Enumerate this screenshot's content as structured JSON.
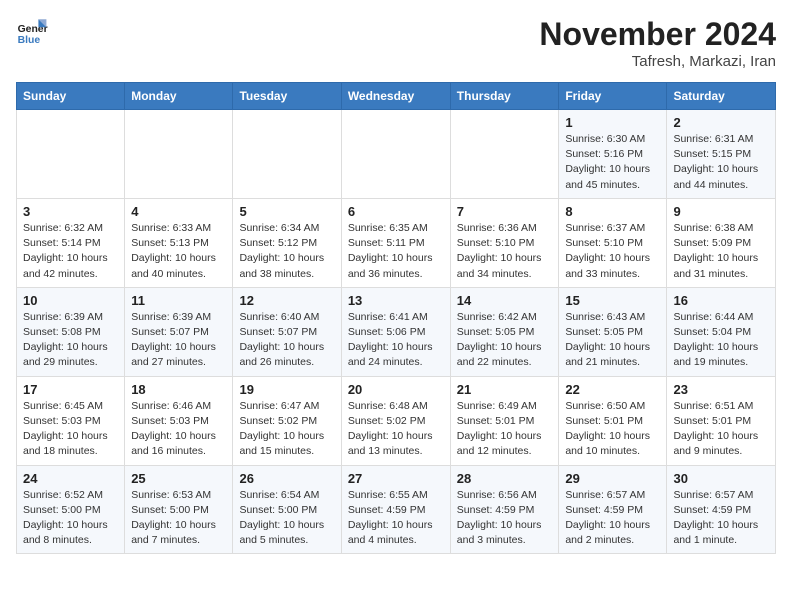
{
  "logo": {
    "line1": "General",
    "line2": "Blue"
  },
  "title": "November 2024",
  "subtitle": "Tafresh, Markazi, Iran",
  "weekdays": [
    "Sunday",
    "Monday",
    "Tuesday",
    "Wednesday",
    "Thursday",
    "Friday",
    "Saturday"
  ],
  "weeks": [
    [
      {
        "day": "",
        "info": ""
      },
      {
        "day": "",
        "info": ""
      },
      {
        "day": "",
        "info": ""
      },
      {
        "day": "",
        "info": ""
      },
      {
        "day": "",
        "info": ""
      },
      {
        "day": "1",
        "info": "Sunrise: 6:30 AM\nSunset: 5:16 PM\nDaylight: 10 hours\nand 45 minutes."
      },
      {
        "day": "2",
        "info": "Sunrise: 6:31 AM\nSunset: 5:15 PM\nDaylight: 10 hours\nand 44 minutes."
      }
    ],
    [
      {
        "day": "3",
        "info": "Sunrise: 6:32 AM\nSunset: 5:14 PM\nDaylight: 10 hours\nand 42 minutes."
      },
      {
        "day": "4",
        "info": "Sunrise: 6:33 AM\nSunset: 5:13 PM\nDaylight: 10 hours\nand 40 minutes."
      },
      {
        "day": "5",
        "info": "Sunrise: 6:34 AM\nSunset: 5:12 PM\nDaylight: 10 hours\nand 38 minutes."
      },
      {
        "day": "6",
        "info": "Sunrise: 6:35 AM\nSunset: 5:11 PM\nDaylight: 10 hours\nand 36 minutes."
      },
      {
        "day": "7",
        "info": "Sunrise: 6:36 AM\nSunset: 5:10 PM\nDaylight: 10 hours\nand 34 minutes."
      },
      {
        "day": "8",
        "info": "Sunrise: 6:37 AM\nSunset: 5:10 PM\nDaylight: 10 hours\nand 33 minutes."
      },
      {
        "day": "9",
        "info": "Sunrise: 6:38 AM\nSunset: 5:09 PM\nDaylight: 10 hours\nand 31 minutes."
      }
    ],
    [
      {
        "day": "10",
        "info": "Sunrise: 6:39 AM\nSunset: 5:08 PM\nDaylight: 10 hours\nand 29 minutes."
      },
      {
        "day": "11",
        "info": "Sunrise: 6:39 AM\nSunset: 5:07 PM\nDaylight: 10 hours\nand 27 minutes."
      },
      {
        "day": "12",
        "info": "Sunrise: 6:40 AM\nSunset: 5:07 PM\nDaylight: 10 hours\nand 26 minutes."
      },
      {
        "day": "13",
        "info": "Sunrise: 6:41 AM\nSunset: 5:06 PM\nDaylight: 10 hours\nand 24 minutes."
      },
      {
        "day": "14",
        "info": "Sunrise: 6:42 AM\nSunset: 5:05 PM\nDaylight: 10 hours\nand 22 minutes."
      },
      {
        "day": "15",
        "info": "Sunrise: 6:43 AM\nSunset: 5:05 PM\nDaylight: 10 hours\nand 21 minutes."
      },
      {
        "day": "16",
        "info": "Sunrise: 6:44 AM\nSunset: 5:04 PM\nDaylight: 10 hours\nand 19 minutes."
      }
    ],
    [
      {
        "day": "17",
        "info": "Sunrise: 6:45 AM\nSunset: 5:03 PM\nDaylight: 10 hours\nand 18 minutes."
      },
      {
        "day": "18",
        "info": "Sunrise: 6:46 AM\nSunset: 5:03 PM\nDaylight: 10 hours\nand 16 minutes."
      },
      {
        "day": "19",
        "info": "Sunrise: 6:47 AM\nSunset: 5:02 PM\nDaylight: 10 hours\nand 15 minutes."
      },
      {
        "day": "20",
        "info": "Sunrise: 6:48 AM\nSunset: 5:02 PM\nDaylight: 10 hours\nand 13 minutes."
      },
      {
        "day": "21",
        "info": "Sunrise: 6:49 AM\nSunset: 5:01 PM\nDaylight: 10 hours\nand 12 minutes."
      },
      {
        "day": "22",
        "info": "Sunrise: 6:50 AM\nSunset: 5:01 PM\nDaylight: 10 hours\nand 10 minutes."
      },
      {
        "day": "23",
        "info": "Sunrise: 6:51 AM\nSunset: 5:01 PM\nDaylight: 10 hours\nand 9 minutes."
      }
    ],
    [
      {
        "day": "24",
        "info": "Sunrise: 6:52 AM\nSunset: 5:00 PM\nDaylight: 10 hours\nand 8 minutes."
      },
      {
        "day": "25",
        "info": "Sunrise: 6:53 AM\nSunset: 5:00 PM\nDaylight: 10 hours\nand 7 minutes."
      },
      {
        "day": "26",
        "info": "Sunrise: 6:54 AM\nSunset: 5:00 PM\nDaylight: 10 hours\nand 5 minutes."
      },
      {
        "day": "27",
        "info": "Sunrise: 6:55 AM\nSunset: 4:59 PM\nDaylight: 10 hours\nand 4 minutes."
      },
      {
        "day": "28",
        "info": "Sunrise: 6:56 AM\nSunset: 4:59 PM\nDaylight: 10 hours\nand 3 minutes."
      },
      {
        "day": "29",
        "info": "Sunrise: 6:57 AM\nSunset: 4:59 PM\nDaylight: 10 hours\nand 2 minutes."
      },
      {
        "day": "30",
        "info": "Sunrise: 6:57 AM\nSunset: 4:59 PM\nDaylight: 10 hours\nand 1 minute."
      }
    ]
  ]
}
